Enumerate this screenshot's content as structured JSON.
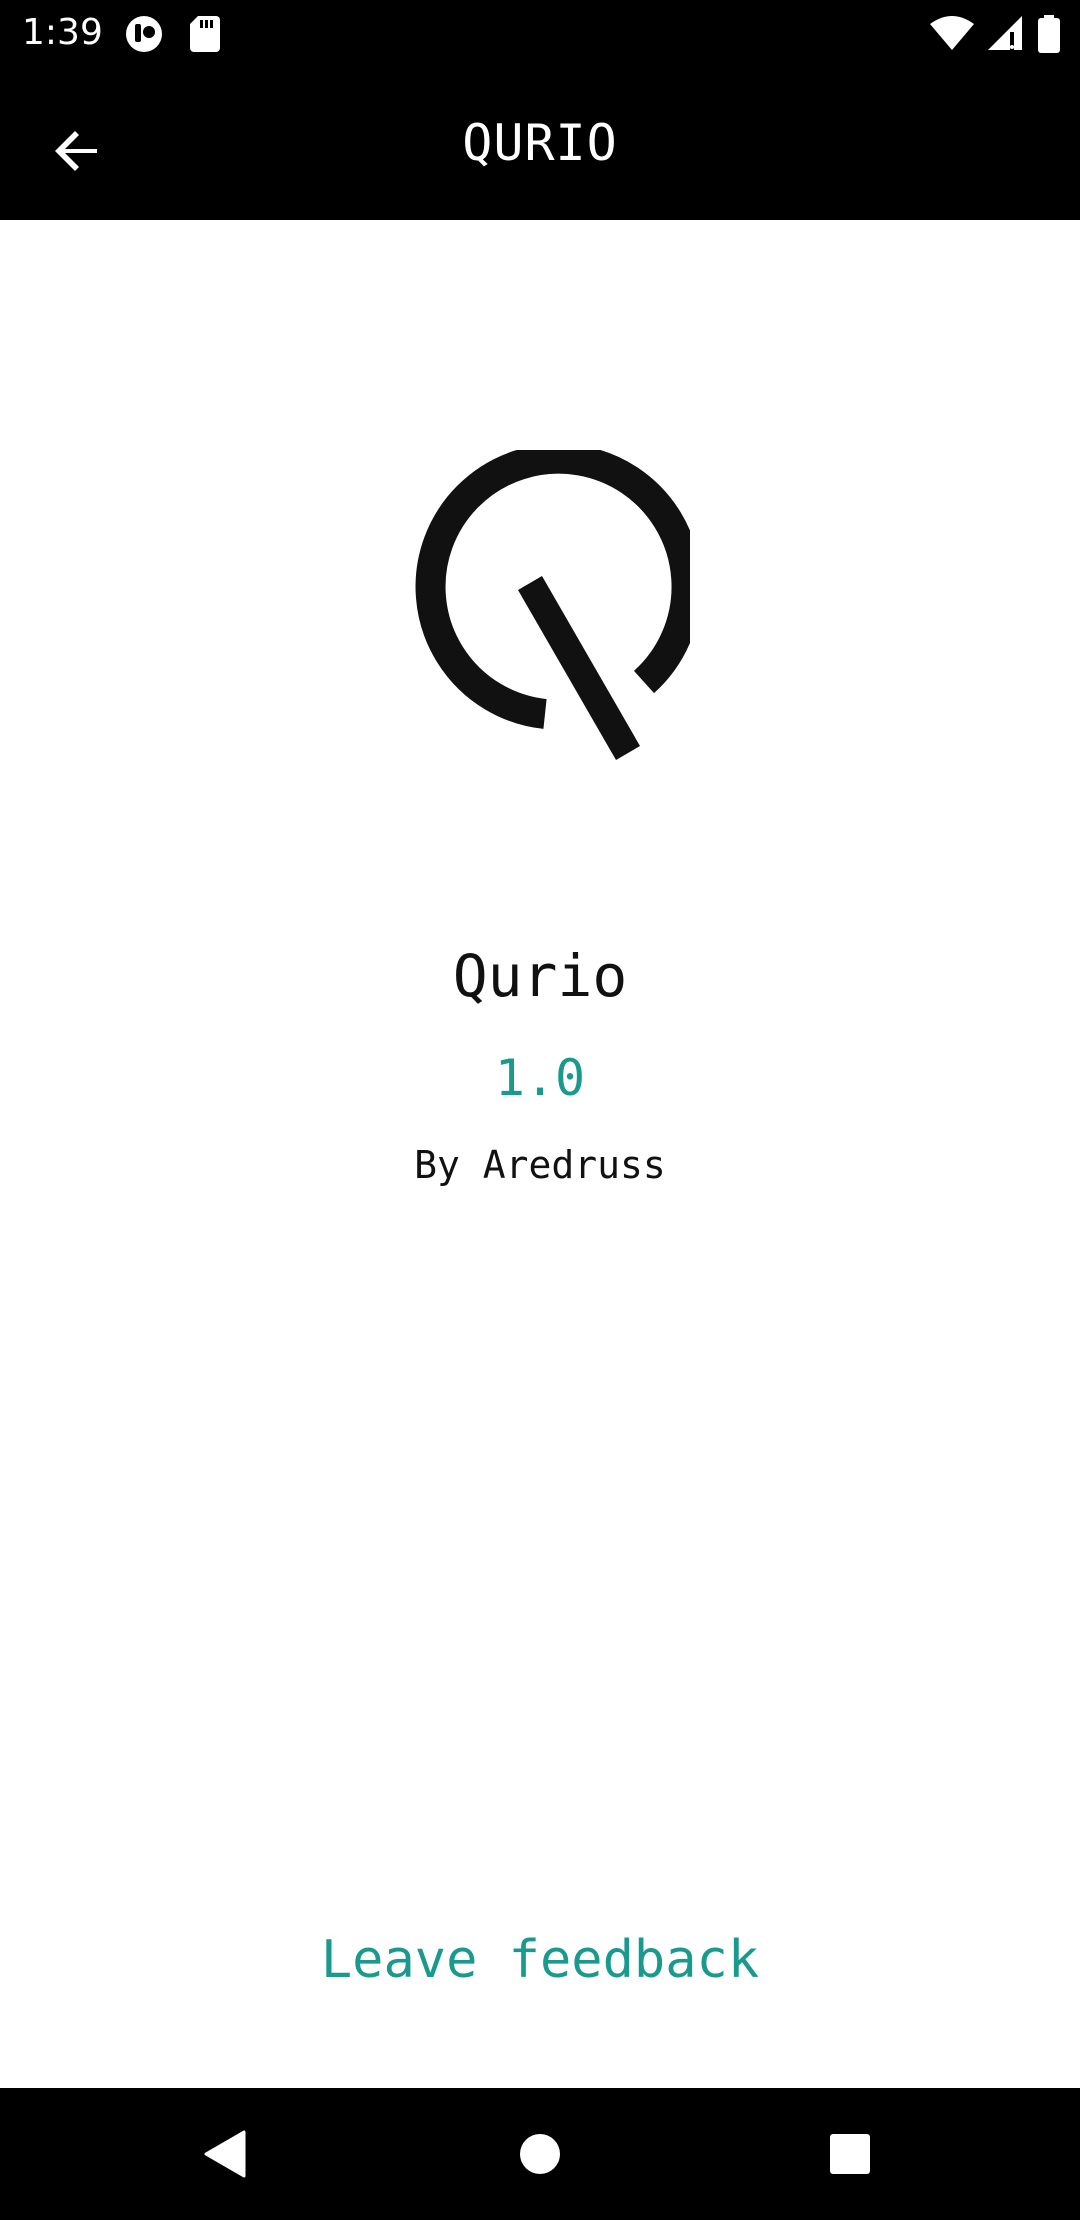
{
  "status_bar": {
    "time": "1:39",
    "left_icons": [
      "media-app-icon",
      "sd-card-icon"
    ],
    "right_icons": [
      "wifi-icon",
      "cell-signal-icon",
      "battery-icon"
    ]
  },
  "app_bar": {
    "title": "QURIO",
    "back_icon": "arrow-back-icon"
  },
  "about": {
    "logo_icon": "qurio-logo-icon",
    "app_name": "Qurio",
    "version": "1.0",
    "author": "By Aredruss"
  },
  "feedback": {
    "label": "Leave feedback"
  },
  "nav_bar": {
    "icons": [
      "nav-back-icon",
      "nav-home-icon",
      "nav-recents-icon"
    ]
  },
  "colors": {
    "accent": "#1a9a8e",
    "bar_background": "#000000",
    "background": "#ffffff",
    "text": "#111111"
  }
}
